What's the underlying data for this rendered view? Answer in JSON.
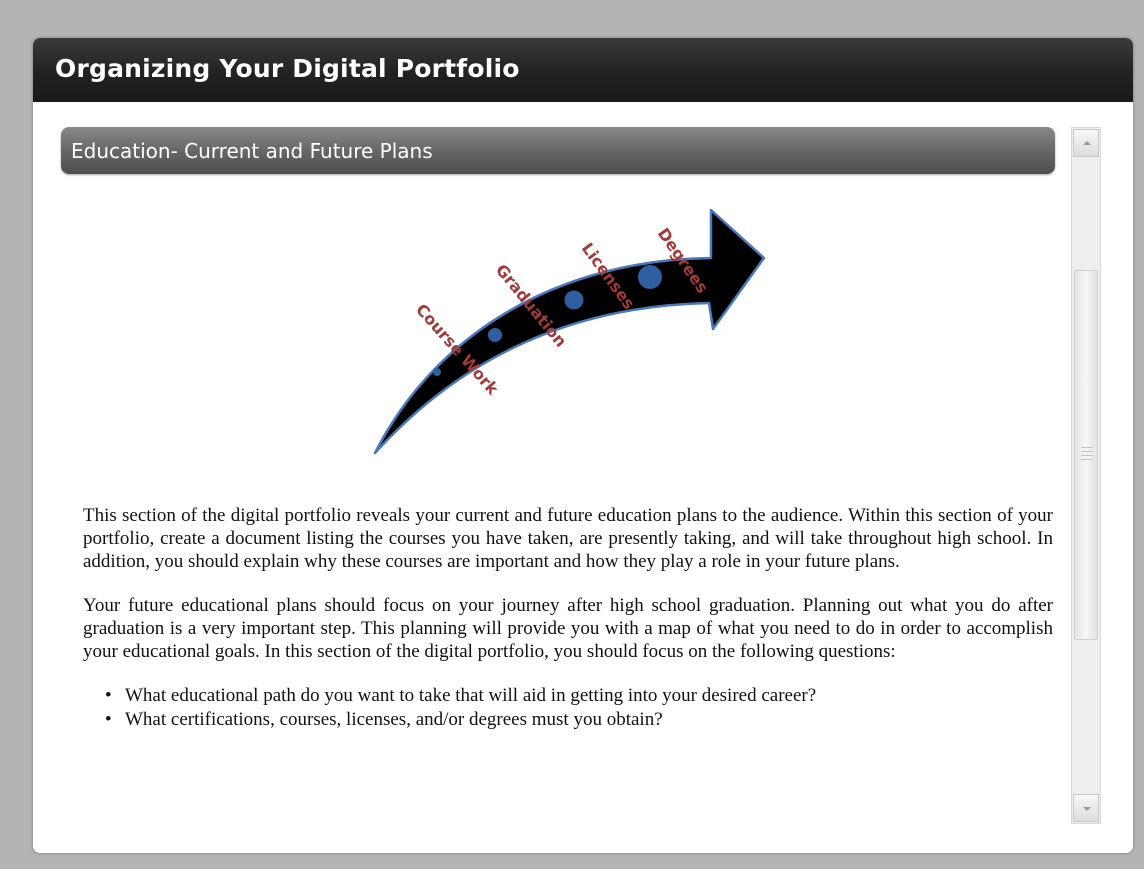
{
  "window": {
    "title": "Organizing Your Digital Portfolio"
  },
  "section": {
    "header": "Education- Current and Future Plans"
  },
  "graphic": {
    "labels": [
      "Course Work",
      "Graduation",
      "Licenses",
      "Degrees"
    ],
    "label_color": "#a23a3a",
    "arrow_color": "#000000",
    "arrow_outline": "#4b78b8",
    "dot_color": "#2f5fa0"
  },
  "content": {
    "paragraph1": "This section of the digital portfolio reveals your current and future education plans to the audience. Within this section of your portfolio, create a document listing the courses you have taken, are presently taking, and will take throughout high school. In addition, you should explain why these courses are important and how they play a role in your future plans.",
    "paragraph2": "Your future educational plans should focus on your journey after high school graduation. Planning out what you do after graduation is a very important step. This planning will provide you with a map of what you need to do in order to accomplish your educational goals. In this section of the digital portfolio, you should focus on the following questions:",
    "questions": [
      "What educational path do you want to take that will aid in getting into your desired career?",
      "What certifications, courses, licenses, and/or degrees must you obtain?"
    ]
  }
}
